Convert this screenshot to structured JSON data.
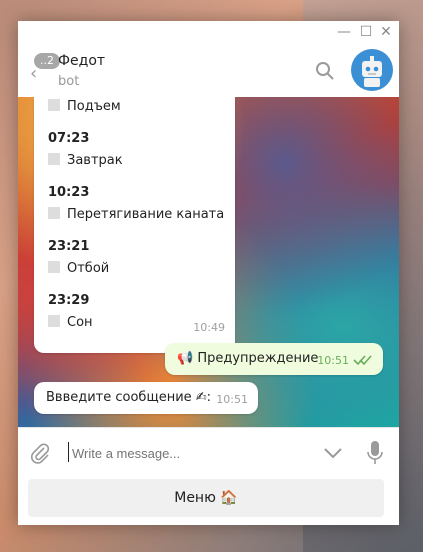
{
  "window": {
    "minimize": "—",
    "maximize": "☐",
    "close": "✕"
  },
  "header": {
    "back_badge": "..2",
    "title": "Федот",
    "subtitle": "bot"
  },
  "schedule": {
    "items": [
      {
        "time": "",
        "label": "Подъем"
      },
      {
        "time": "07:23",
        "label": "Завтрак"
      },
      {
        "time": "10:23",
        "label": "Перетягивание каната"
      },
      {
        "time": "23:21",
        "label": "Отбой"
      },
      {
        "time": "23:29",
        "label": "Сон"
      }
    ],
    "msg_time": "10:49"
  },
  "messages": {
    "outgoing": {
      "text": "📢 Предупреждение",
      "time": "10:51"
    },
    "incoming": {
      "text": "Ввведите сообщение ✍:",
      "time": "10:51"
    }
  },
  "composer": {
    "placeholder": "Write a message..."
  },
  "keyboard": {
    "menu_label": "Меню 🏠"
  }
}
